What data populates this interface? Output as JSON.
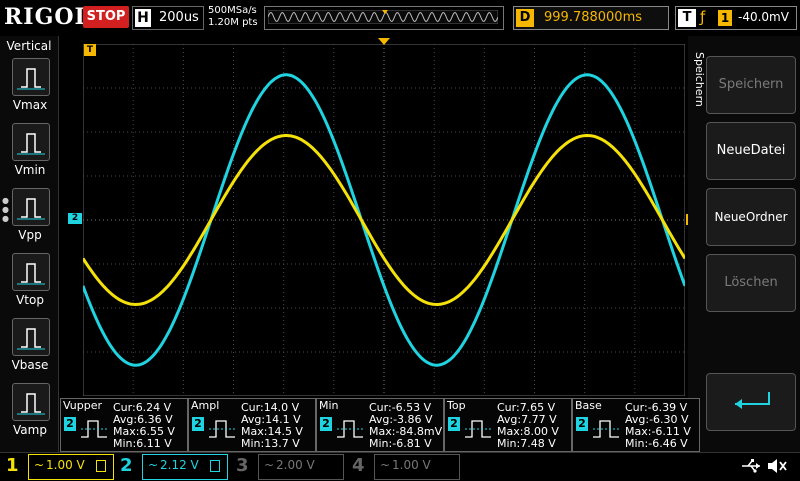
{
  "header": {
    "brand": "RIGOL",
    "run_state": "STOP",
    "horizontal_key": "H",
    "timebase": "200us",
    "sample_rate": "500MSa/s",
    "memory_depth": "1.20M pts",
    "delay_key": "D",
    "delay_value": "999.788000ms",
    "trigger_key": "T",
    "trigger_channel": "1",
    "trigger_level": "-40.0mV"
  },
  "left_panel": {
    "title": "Vertical",
    "items": [
      "Vmax",
      "Vmin",
      "Vpp",
      "Vtop",
      "Vbase",
      "Vamp"
    ]
  },
  "right_panel": {
    "title": "Speichern",
    "buttons": [
      "Speichern",
      "NeueDatei",
      "NeueOrdner",
      "Löschen"
    ]
  },
  "markers": {
    "trigger_marker": "T",
    "ch2_marker": "2",
    "trigger_level_marker": "T"
  },
  "measurements": [
    {
      "name": "Vupper",
      "channel": "2",
      "cur": "Cur:6.24 V",
      "avg": "Avg:6.36 V",
      "max": "Max:6.55 V",
      "min": "Min:6.11 V"
    },
    {
      "name": "Ampl",
      "channel": "2",
      "cur": "Cur:14.0 V",
      "avg": "Avg:14.1 V",
      "max": "Max:14.5 V",
      "min": "Min:13.7 V"
    },
    {
      "name": "Min",
      "channel": "2",
      "cur": "Cur:-6.53 V",
      "avg": "Avg:-3.86 V",
      "max": "Max:-84.8mV",
      "min": "Min:-6.81 V"
    },
    {
      "name": "Top",
      "channel": "2",
      "cur": "Cur:7.65 V",
      "avg": "Avg:7.77 V",
      "max": "Max:8.00 V",
      "min": "Min:7.48 V"
    },
    {
      "name": "Base",
      "channel": "2",
      "cur": "Cur:-6.39 V",
      "avg": "Avg:-6.30 V",
      "max": "Max:-6.11 V",
      "min": "Min:-6.46 V"
    }
  ],
  "channels": [
    {
      "num": "1",
      "scale": "1.00 V",
      "color": "#f5e10a",
      "active": true
    },
    {
      "num": "2",
      "scale": "2.12 V",
      "color": "#1fd3e0",
      "active": true
    },
    {
      "num": "3",
      "scale": "2.00 V",
      "color": "#c05aa8",
      "active": false
    },
    {
      "num": "4",
      "scale": "1.00 V",
      "color": "#4a7bd0",
      "active": false
    }
  ],
  "coupling_symbol": "~",
  "colors": {
    "ch1": "#f5e10a",
    "ch2": "#1fd3e0",
    "accent": "#f5b700",
    "stop": "#d21f1f"
  },
  "waveforms": {
    "cycles": 2.0,
    "phase_deg": 180,
    "ch1_amplitude_div": 1.92,
    "ch2_amplitude_div": 3.3,
    "offset_div": 0.0
  }
}
